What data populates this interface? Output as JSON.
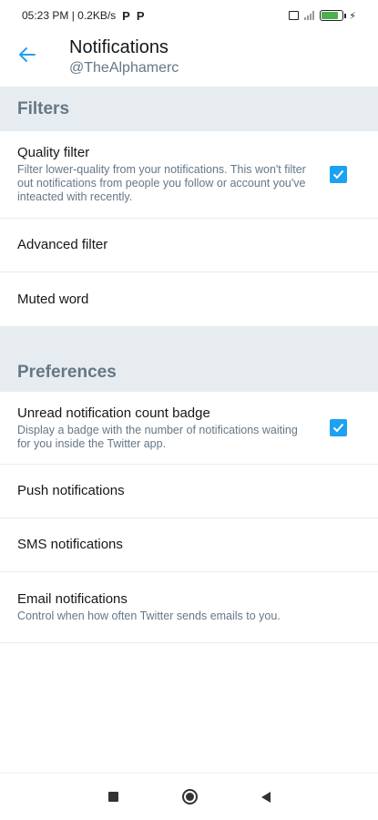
{
  "status_bar": {
    "time_info": "05:23 PM | 0.2KB/s",
    "p_icons": [
      "P",
      "P"
    ]
  },
  "header": {
    "title": "Notifications",
    "subtitle": "@TheAlphamerc"
  },
  "filters": {
    "section_title": "Filters",
    "quality_filter": {
      "label": "Quality filter",
      "description": "Filter lower-quality from your notifications. This won't filter out notifications from people you follow or account you've inteacted with recently.",
      "checked": true
    },
    "advanced_filter": {
      "label": "Advanced filter"
    },
    "muted_word": {
      "label": "Muted word"
    }
  },
  "preferences": {
    "section_title": "Preferences",
    "unread_badge": {
      "label": "Unread notification count badge",
      "description": "Display a badge with the number of notifications waiting for you inside the Twitter app.",
      "checked": true
    },
    "push_notifications": {
      "label": "Push notifications"
    },
    "sms_notifications": {
      "label": "SMS notifications"
    },
    "email_notifications": {
      "label": "Email notifications",
      "description": "Control when how often Twitter sends emails to you."
    }
  },
  "colors": {
    "accent": "#1da1f2",
    "section_bg": "#e6ecf0",
    "secondary_text": "#657786"
  }
}
